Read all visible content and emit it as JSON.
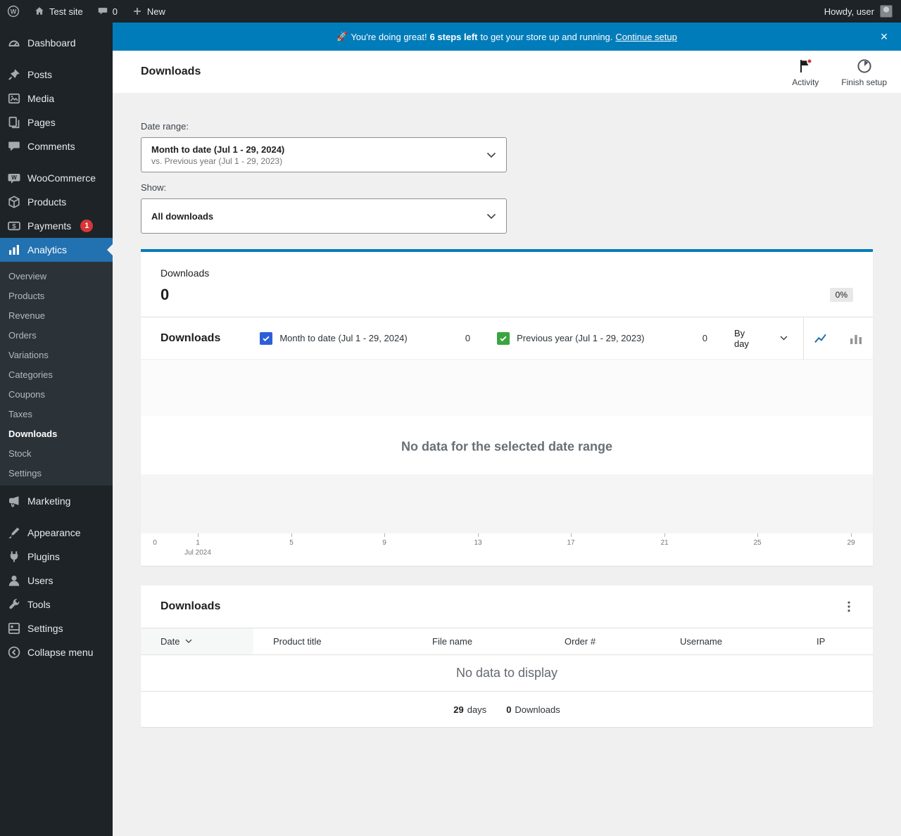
{
  "admin_bar": {
    "site_name": "Test site",
    "comments_count": "0",
    "new_label": "New",
    "howdy": "Howdy, user"
  },
  "banner": {
    "emoji": "🚀",
    "lead": "You're doing great!",
    "bold": "6 steps left",
    "rest": "to get your store up and running.",
    "link": "Continue setup",
    "close": "×"
  },
  "header": {
    "title": "Downloads",
    "activity_label": "Activity",
    "finish_setup_label": "Finish setup"
  },
  "sidebar": {
    "items": [
      {
        "label": "Dashboard"
      },
      {
        "label": "Posts"
      },
      {
        "label": "Media"
      },
      {
        "label": "Pages"
      },
      {
        "label": "Comments"
      },
      {
        "label": "WooCommerce"
      },
      {
        "label": "Products"
      },
      {
        "label": "Payments",
        "badge": "1"
      },
      {
        "label": "Analytics"
      },
      {
        "label": "Marketing"
      },
      {
        "label": "Appearance"
      },
      {
        "label": "Plugins"
      },
      {
        "label": "Users"
      },
      {
        "label": "Tools"
      },
      {
        "label": "Settings"
      }
    ],
    "analytics_submenu": [
      {
        "label": "Overview"
      },
      {
        "label": "Products"
      },
      {
        "label": "Revenue"
      },
      {
        "label": "Orders"
      },
      {
        "label": "Variations"
      },
      {
        "label": "Categories"
      },
      {
        "label": "Coupons"
      },
      {
        "label": "Taxes"
      },
      {
        "label": "Downloads"
      },
      {
        "label": "Stock"
      },
      {
        "label": "Settings"
      }
    ],
    "collapse_label": "Collapse menu"
  },
  "filters": {
    "date_range_label": "Date range:",
    "date_range_value": "Month to date (Jul 1 - 29, 2024)",
    "date_range_sub": "vs. Previous year (Jul 1 - 29, 2023)",
    "show_label": "Show:",
    "show_value": "All downloads"
  },
  "summary": {
    "tab_label": "Downloads",
    "value": "0",
    "delta": "0%"
  },
  "chart": {
    "type": "line",
    "title": "Downloads",
    "series": [
      {
        "label": "Month to date (Jul 1 - 29, 2024)",
        "value": "0",
        "color": "#2d5fd9",
        "values": []
      },
      {
        "label": "Previous year (Jul 1 - 29, 2023)",
        "value": "0",
        "color": "#3aa53f",
        "values": []
      }
    ],
    "interval": "By day",
    "empty_message": "No data for the selected date range",
    "x_ticks": [
      "0",
      "1",
      "5",
      "9",
      "13",
      "17",
      "21",
      "25",
      "29"
    ],
    "x_axis_sublabel": "Jul 2024"
  },
  "table": {
    "title": "Downloads",
    "headers": [
      "Date",
      "Product title",
      "File name",
      "Order #",
      "Username",
      "IP"
    ],
    "empty_message": "No data to display",
    "summary": {
      "days_value": "29",
      "days_label": "days",
      "downloads_value": "0",
      "downloads_label": "Downloads"
    }
  },
  "icons": {
    "header": [
      "activity-flag-icon",
      "finish-setup-timer-icon"
    ],
    "chart_toggles": [
      "line-chart-icon",
      "bar-chart-icon"
    ],
    "table_menu": "ellipsis-icon"
  },
  "colors": {
    "accent": "#007cba",
    "active_menu": "#2271b1",
    "alert_badge": "#d63638"
  }
}
